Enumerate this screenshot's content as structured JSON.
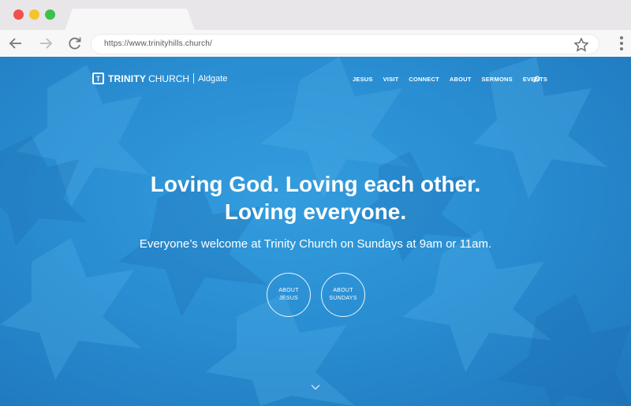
{
  "browser": {
    "url": "https://www.trinityhills.church/"
  },
  "site": {
    "brand": {
      "mark": "T",
      "name_bold": "TRINITY",
      "name_light": "CHURCH",
      "location": "Aldgate"
    },
    "menu": [
      "JESUS",
      "VISIT",
      "CONNECT",
      "ABOUT",
      "SERMONS",
      "EVENTS"
    ],
    "hero": {
      "headline_line1": "Loving God. Loving each other.",
      "headline_line2": "Loving everyone.",
      "subline": "Everyone’s welcome at Trinity Church on Sundays at 9am or 11am.",
      "buttons": [
        {
          "line1": "ABOUT",
          "line2": "JESUS"
        },
        {
          "line1": "ABOUT",
          "line2": "SUNDAYS"
        }
      ]
    }
  },
  "colors": {
    "hero_blue": "#2d8fd0",
    "traffic_red": "#f24e4c",
    "traffic_yellow": "#f5c42c",
    "traffic_green": "#3cc24a"
  }
}
